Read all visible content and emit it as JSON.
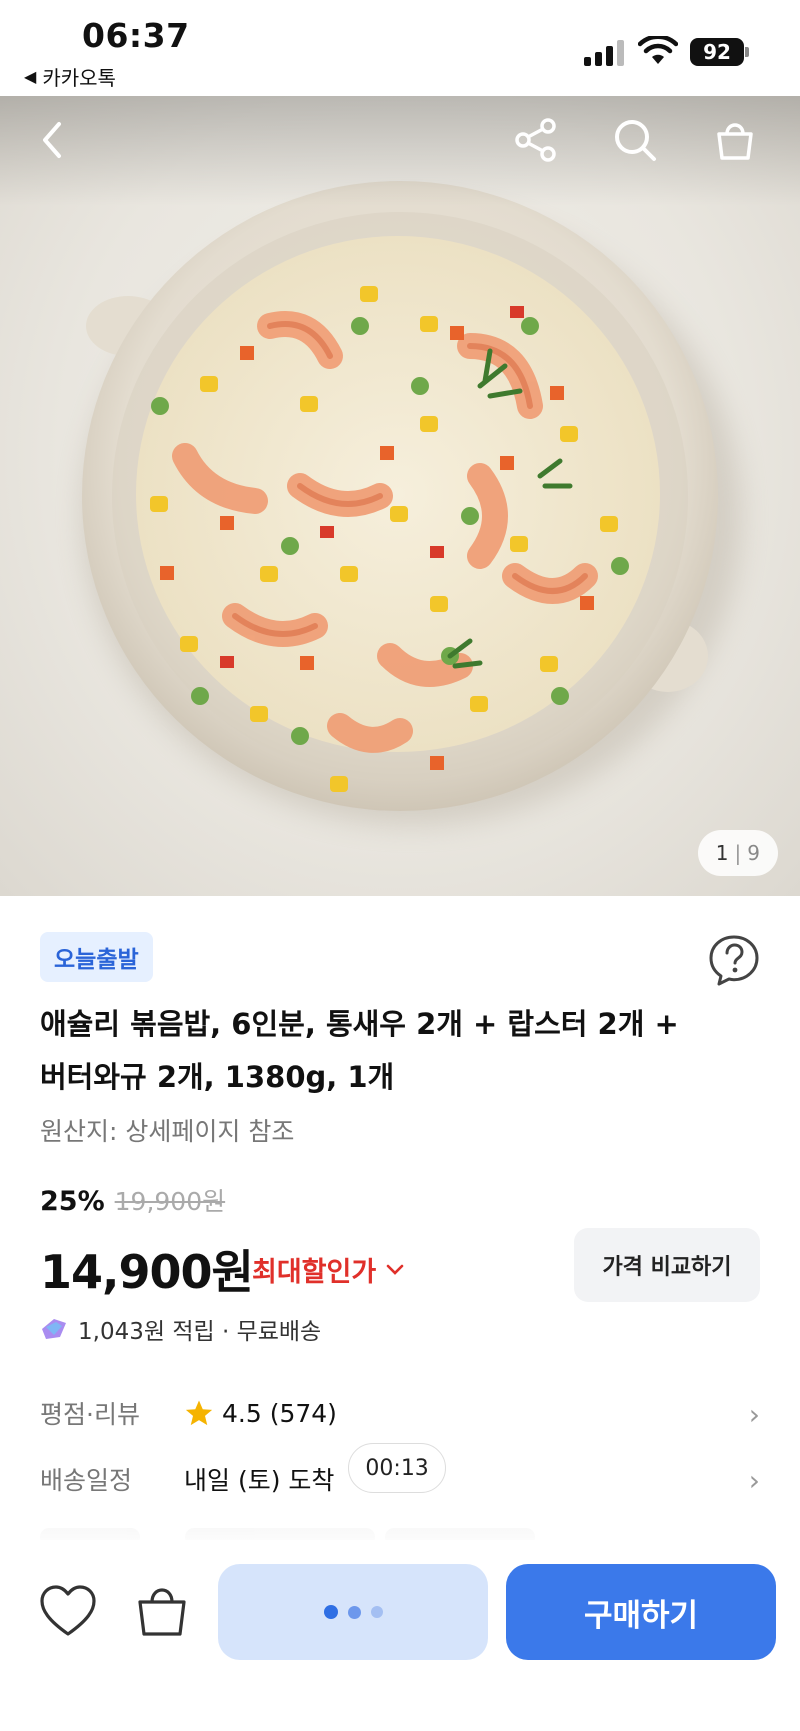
{
  "status_bar": {
    "time": "06:37",
    "back_app": "카카오톡",
    "battery": "92"
  },
  "hero": {
    "page_current": "1",
    "page_total": "9"
  },
  "product": {
    "badge": "오늘출발",
    "title_line1": "애슐리 볶음밥, 6인분, 통새우 2개 + 랍스터 2개 +",
    "title_line2": "버터와규 2개, 1380g, 1개",
    "origin": "원산지: 상세페이지 참조",
    "discount_rate": "25%",
    "original_price": "19,900원",
    "price": "14,900원",
    "max_discount_label": "최대할인가",
    "compare_label": "가격 비교하기",
    "reward_text": "1,043원 적립 · 무료배송"
  },
  "rows": {
    "rating_key": "평점·리뷰",
    "rating_value": "4.5 (574)",
    "delivery_key": "배송일정",
    "delivery_value": "내일 (토) 도착",
    "timer": "00:13"
  },
  "bottom": {
    "buy_label": "구매하기"
  },
  "colors": {
    "accent": "#3b79ea",
    "discount_red": "#e0302a",
    "badge_bg": "#e6f0ff",
    "star": "#f5b301"
  }
}
